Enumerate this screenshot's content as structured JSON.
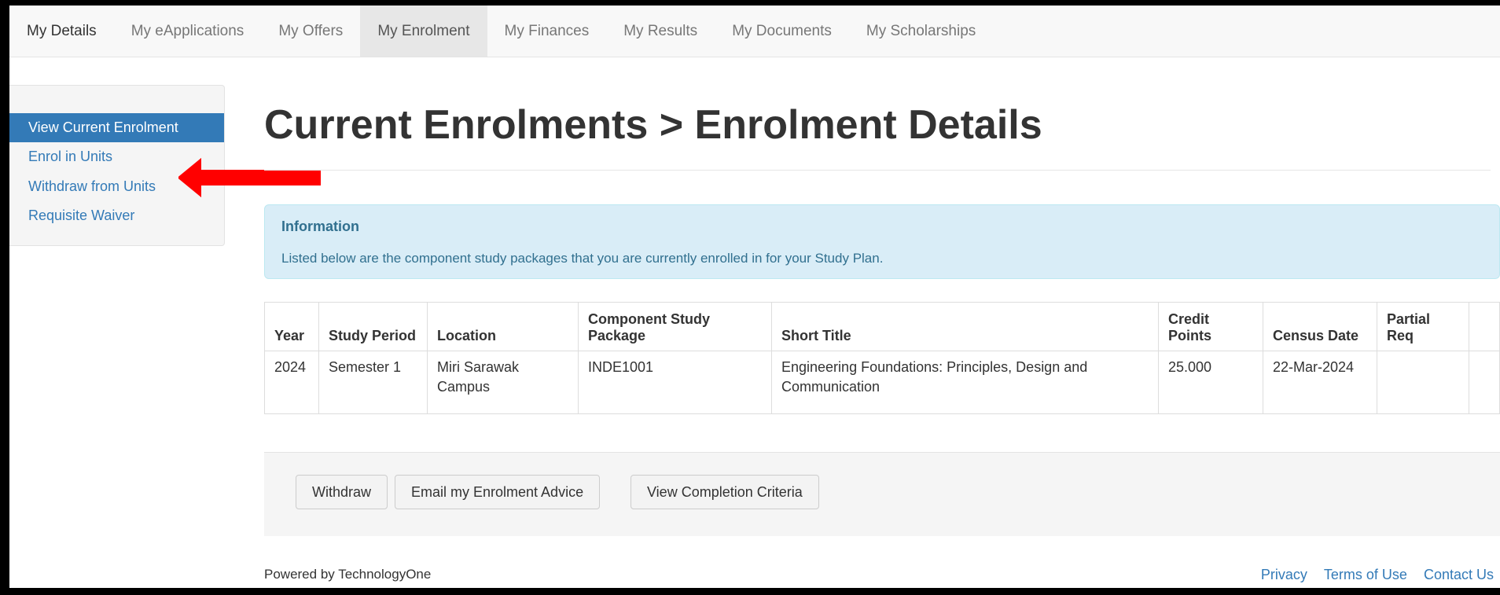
{
  "nav": {
    "tabs": [
      {
        "label": "My Details"
      },
      {
        "label": "My eApplications"
      },
      {
        "label": "My Offers"
      },
      {
        "label": "My Enrolment"
      },
      {
        "label": "My Finances"
      },
      {
        "label": "My Results"
      },
      {
        "label": "My Documents"
      },
      {
        "label": "My Scholarships"
      }
    ],
    "active_tab": "My Enrolment"
  },
  "sidebar": {
    "items": [
      {
        "label": "View Current Enrolment"
      },
      {
        "label": "Enrol in Units"
      },
      {
        "label": "Withdraw from Units"
      },
      {
        "label": "Requisite Waiver"
      }
    ],
    "active_item": "View Current Enrolment"
  },
  "annotation": {
    "color": "#ff0000",
    "points_to": "Withdraw from Units"
  },
  "main": {
    "title": "Current Enrolments > Enrolment Details",
    "info": {
      "title": "Information",
      "text": "Listed below are the component study packages that you are currently enrolled in for your Study Plan."
    },
    "table": {
      "headers": [
        "Year",
        "Study Period",
        "Location",
        "Component Study Package",
        "Short Title",
        "Credit Points",
        "Census Date",
        "Partial Req",
        ""
      ],
      "rows": [
        [
          "2024",
          "Semester 1",
          "Miri Sarawak Campus",
          "INDE1001",
          "Engineering Foundations: Principles, Design and Communication",
          "25.000",
          "22-Mar-2024",
          "",
          ""
        ]
      ]
    },
    "buttons": {
      "withdraw": "Withdraw",
      "email": "Email my Enrolment Advice",
      "completion": "View Completion Criteria"
    }
  },
  "footer": {
    "powered_by": "Powered by TechnologyOne",
    "privacy": "Privacy",
    "terms": "Terms of Use",
    "contact": "Contact Us"
  },
  "colors": {
    "link": "#337ab7",
    "active_sidebar": "#337ab7",
    "info_bg": "#d9edf7",
    "info_text": "#31708f"
  }
}
